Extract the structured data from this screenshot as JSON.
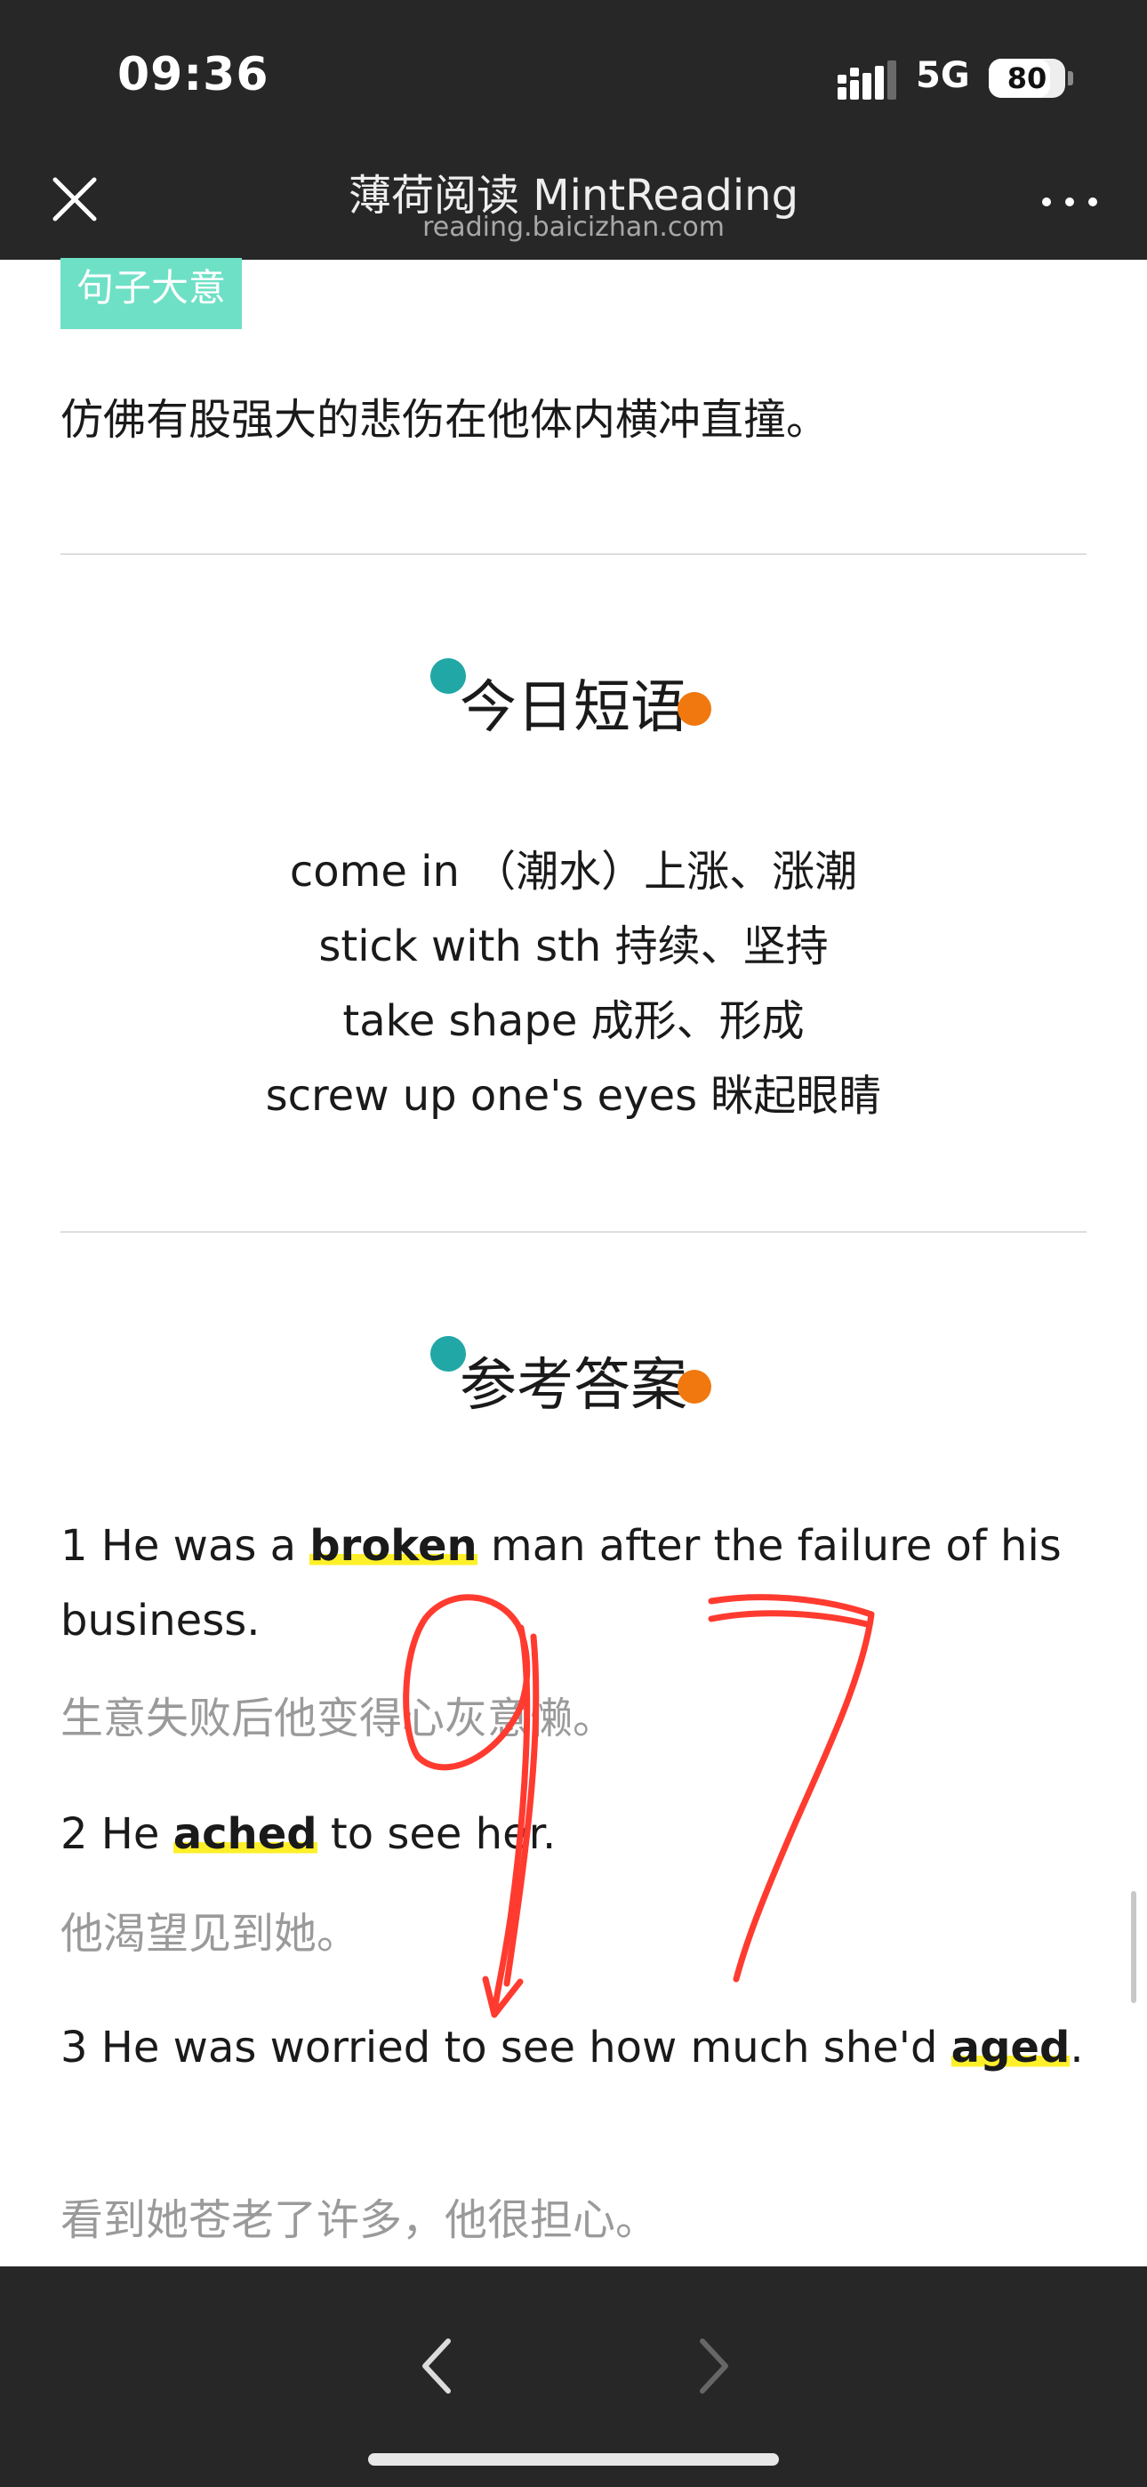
{
  "status_bar": {
    "time": "09:36",
    "network": "5G",
    "battery": "80",
    "battery_level_pct": 80,
    "icons": [
      "cellular-signal-icon",
      "battery-icon"
    ]
  },
  "header": {
    "title": "薄荷阅读 MintReading",
    "subtitle": "reading.baicizhan.com",
    "icons": [
      "close-icon",
      "more-icon"
    ]
  },
  "sentence_section": {
    "tag": "句子大意",
    "meaning": "仿佛有股强大的悲伤在他体内横冲直撞。"
  },
  "phrases_section": {
    "heading": "今日短语",
    "items": [
      "come in （潮水）上涨、涨潮",
      "stick with sth 持续、坚持",
      "take shape 成形、形成",
      "screw up one's eyes 眯起眼睛"
    ]
  },
  "answers_section": {
    "heading": "参考答案",
    "items": [
      {
        "pre": "1 He was a ",
        "keyword": "broken",
        "post": " man after the failure of his business.",
        "cn": "生意失败后他变得心灰意懒。"
      },
      {
        "pre": "2 He ",
        "keyword": "ached",
        "post": " to see her.",
        "cn": "他渴望见到她。"
      },
      {
        "pre": "3 He was worried to see how much she'd ",
        "keyword": "aged",
        "post": ".",
        "cn": "看到她苍老了许多，他很担心。"
      }
    ]
  },
  "annotation": {
    "handwritten_mark": "97",
    "color": "#ff3b30"
  },
  "colors": {
    "bar_background": "#272727",
    "tag_background": "#6ee0c6",
    "highlight": "#fdf02a",
    "dot_teal": "#21a7a6",
    "dot_orange": "#f0780f"
  },
  "bottom_bar": {
    "icons": [
      "chevron-left-icon",
      "chevron-right-icon"
    ]
  }
}
